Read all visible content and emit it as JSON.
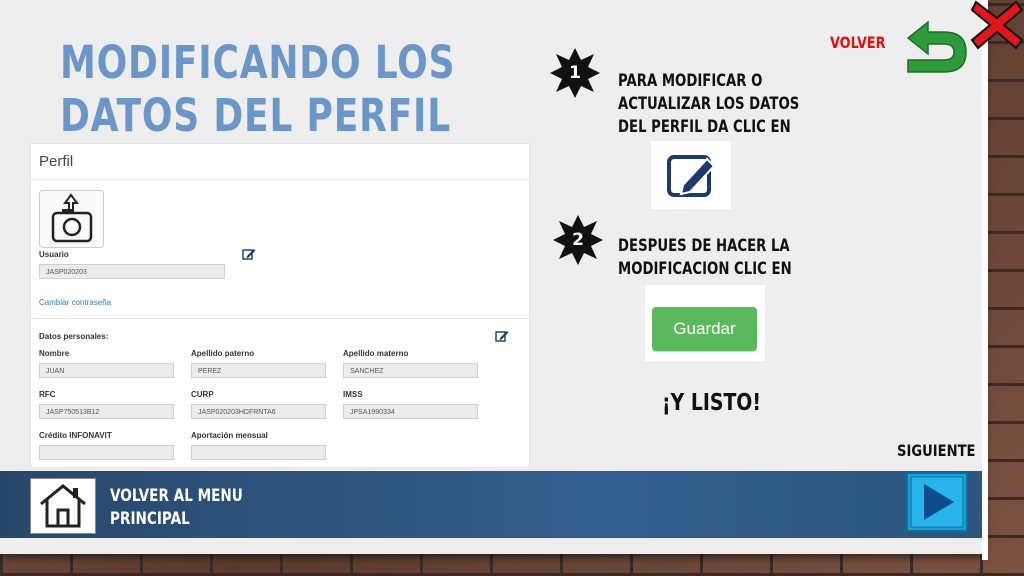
{
  "slide": {
    "title_line1": "MODIFICANDO LOS",
    "title_line2": "DATOS DEL PERFIL",
    "volver_label": "VOLVER",
    "siguiente_label": "SIGUIENTE",
    "menu_line1": "VOLVER AL MENU",
    "menu_line2": "PRINCIPAL",
    "step1_number": "1",
    "step1_text_line1": "PARA MODIFICAR O",
    "step1_text_line2": "ACTUALIZAR LOS DATOS",
    "step1_text_line3": "DEL PERFIL DA CLIC EN",
    "step2_number": "2",
    "step2_text_line1": "DESPUES DE HACER LA",
    "step2_text_line2": "MODIFICACION CLIC EN",
    "guardar_label": "Guardar",
    "listo_text": "¡Y LISTO!",
    "icons": {
      "back": "green-u-turn-arrow-icon",
      "close": "red-x-icon",
      "home": "house-icon",
      "next": "blue-play-arrow-icon",
      "edit": "pencil-square-icon"
    },
    "colors": {
      "title": "#6b96c8",
      "volver": "#e01010",
      "bar": "#345e8e",
      "guardar": "#5cb85c"
    }
  },
  "profile": {
    "title": "Perfil",
    "usuario_label": "Usuario",
    "usuario_value": "JASP020203",
    "change_password": "Cambiar contraseña",
    "personal_header": "Datos personales:",
    "fields": [
      {
        "label": "Nombre",
        "value": "JUAN"
      },
      {
        "label": "Apellido paterno",
        "value": "PEREZ"
      },
      {
        "label": "Apellido materno",
        "value": "SANCHEZ"
      },
      {
        "label": "RFC",
        "value": "JASP750513B12"
      },
      {
        "label": "CURP",
        "value": "JASP020203HDFRNTA6"
      },
      {
        "label": "IMSS",
        "value": "JPSA1990334"
      },
      {
        "label": "Crédito INFONAVIT",
        "value": ""
      },
      {
        "label": "Aportación mensual",
        "value": ""
      }
    ]
  }
}
